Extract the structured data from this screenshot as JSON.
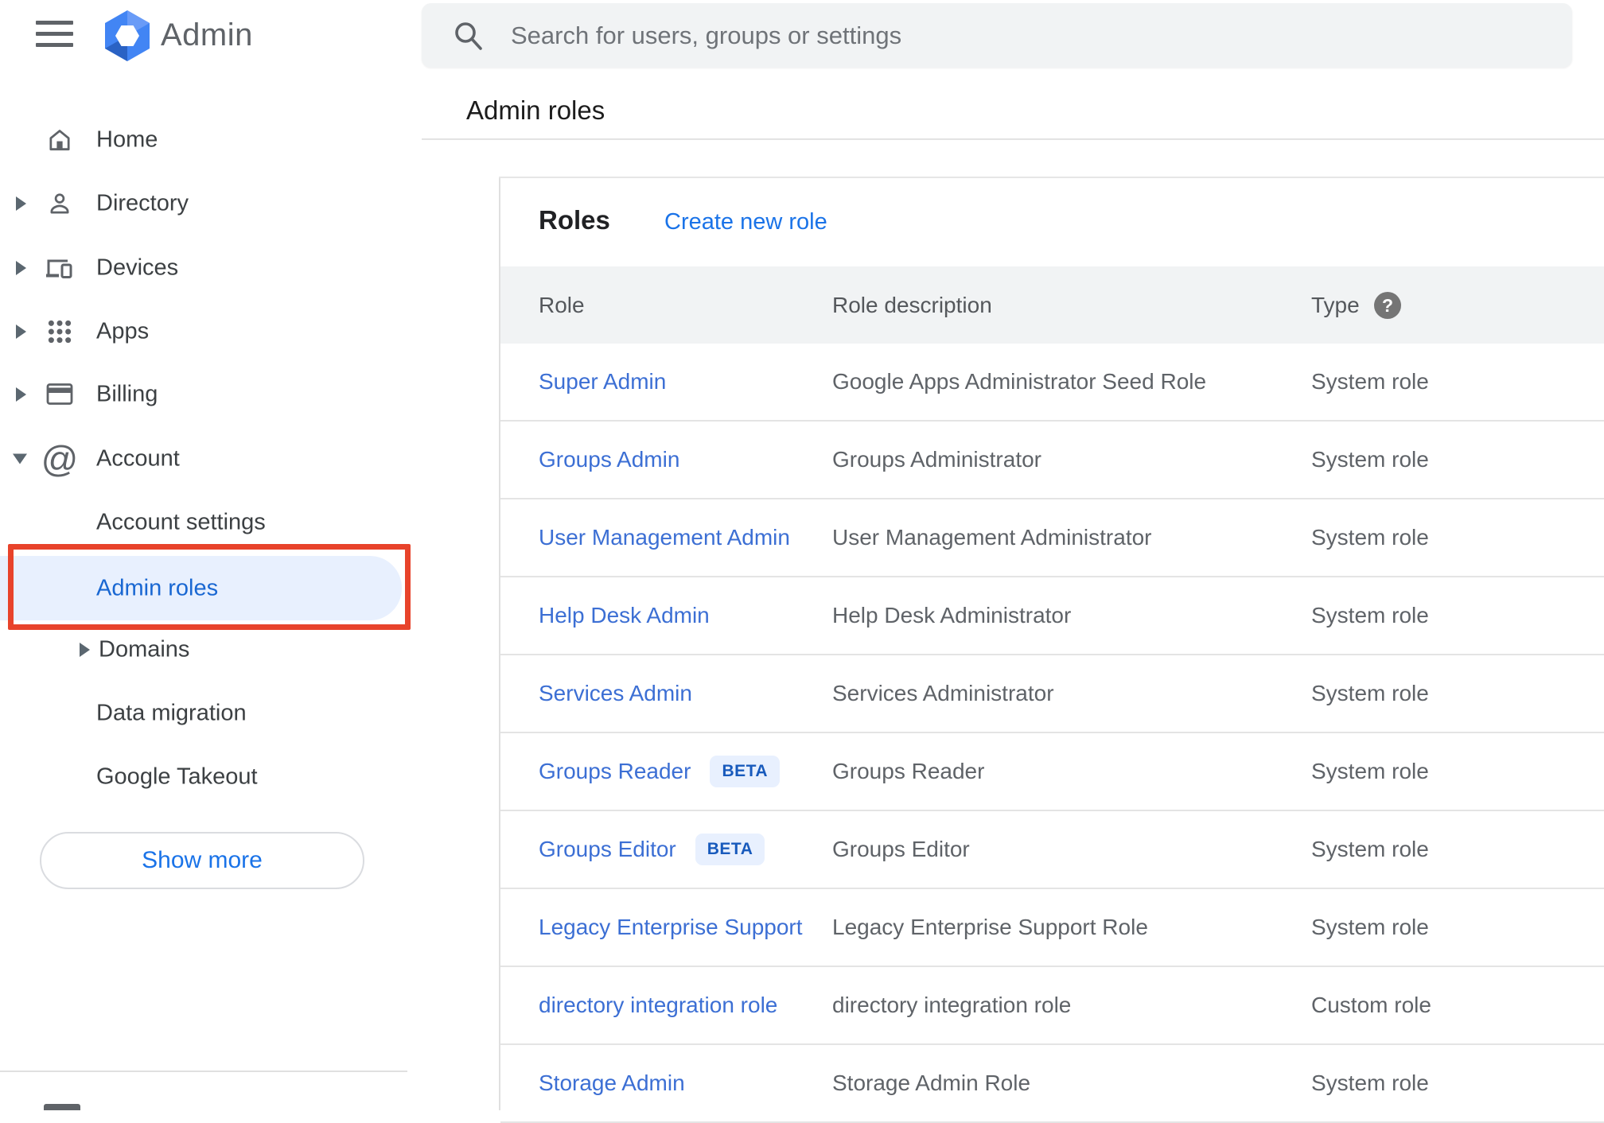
{
  "header": {
    "app_title": "Admin",
    "search_placeholder": "Search for users, groups or settings"
  },
  "breadcrumb": "Admin roles",
  "sidebar": {
    "items": [
      {
        "label": "Home"
      },
      {
        "label": "Directory"
      },
      {
        "label": "Devices"
      },
      {
        "label": "Apps"
      },
      {
        "label": "Billing"
      },
      {
        "label": "Account"
      }
    ],
    "account_children": [
      {
        "label": "Account settings"
      },
      {
        "label": "Admin roles",
        "selected": true
      },
      {
        "label": "Domains"
      },
      {
        "label": "Data migration"
      },
      {
        "label": "Google Takeout"
      }
    ],
    "show_more_label": "Show more"
  },
  "main": {
    "panel_title": "Roles",
    "create_link": "Create new role",
    "columns": {
      "role": "Role",
      "description": "Role description",
      "type": "Type"
    },
    "beta_label": "BETA",
    "rows": [
      {
        "role": "Super Admin",
        "description": "Google Apps Administrator Seed Role",
        "type": "System role"
      },
      {
        "role": "Groups Admin",
        "description": "Groups Administrator",
        "type": "System role"
      },
      {
        "role": "User Management Admin",
        "description": "User Management Administrator",
        "type": "System role"
      },
      {
        "role": "Help Desk Admin",
        "description": "Help Desk Administrator",
        "type": "System role"
      },
      {
        "role": "Services Admin",
        "description": "Services Administrator",
        "type": "System role"
      },
      {
        "role": "Groups Reader",
        "description": "Groups Reader",
        "type": "System role",
        "beta": true
      },
      {
        "role": "Groups Editor",
        "description": "Groups Editor",
        "type": "System role",
        "beta": true
      },
      {
        "role": "Legacy Enterprise Support",
        "description": "Legacy Enterprise Support Role",
        "type": "System role"
      },
      {
        "role": "directory integration role",
        "description": "directory integration role",
        "type": "Custom role"
      },
      {
        "role": "Storage Admin",
        "description": "Storage Admin Role",
        "type": "System role"
      }
    ]
  },
  "colors": {
    "accent_link": "#1a73e8",
    "row_link": "#3c6fd4",
    "selected_item_text": "#1967d2",
    "selected_item_bg": "#e8f0fe",
    "annotation_red": "#e8432b",
    "beta_text": "#185abc",
    "beta_bg": "#e8f0fe",
    "header_band_bg": "#f1f3f4"
  }
}
